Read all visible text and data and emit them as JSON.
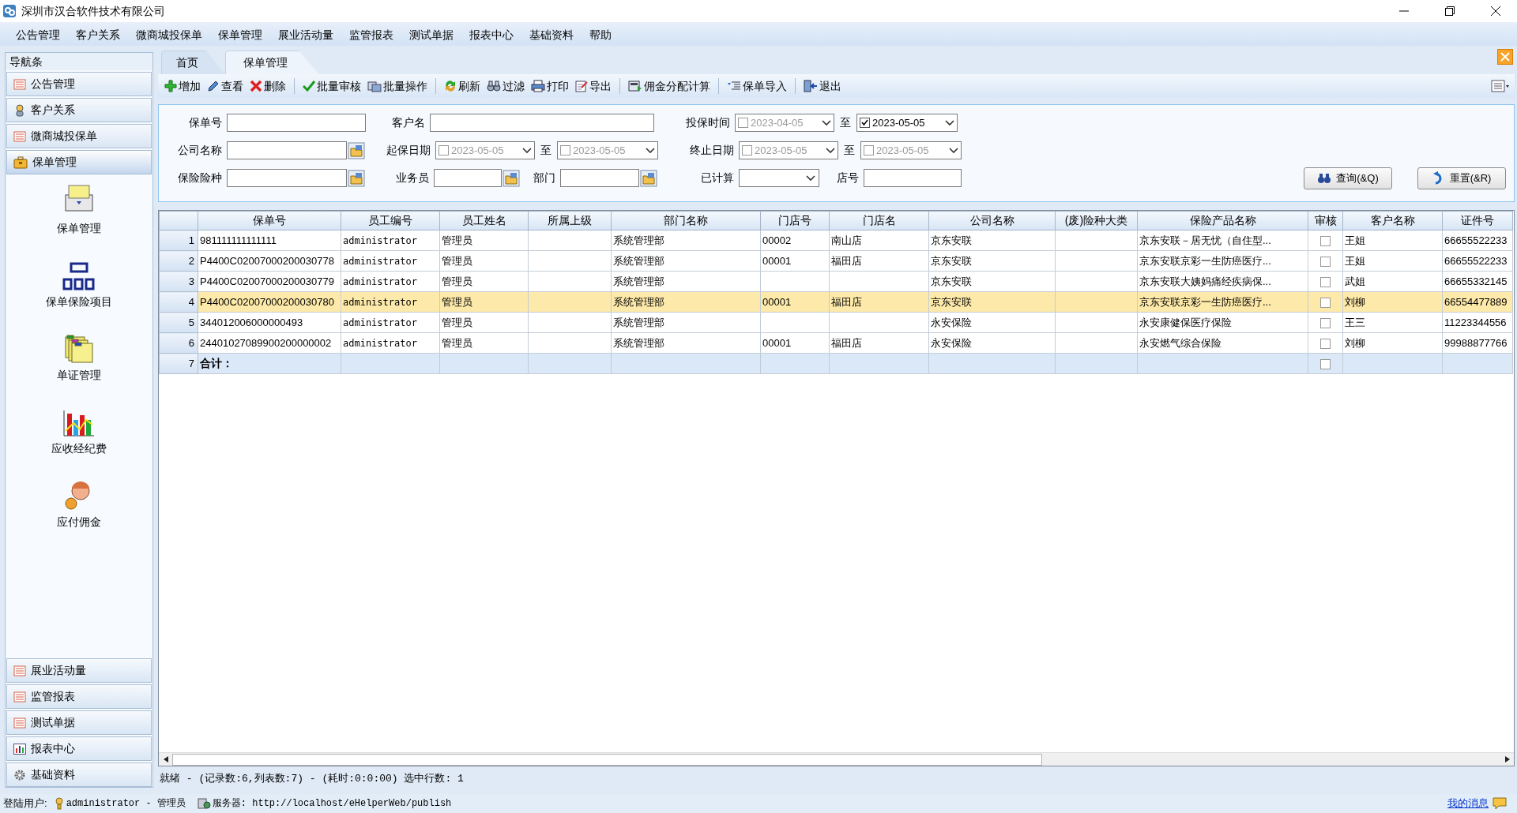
{
  "window": {
    "title": "深圳市汉合软件技术有限公司"
  },
  "menu": [
    "公告管理",
    "客户关系",
    "微商城投保单",
    "保单管理",
    "展业活动量",
    "监管报表",
    "测试单据",
    "报表中心",
    "基础资料",
    "帮助"
  ],
  "sidebar": {
    "title": "导航条",
    "top_sections": [
      {
        "label": "公告管理",
        "kind": "list",
        "expanded": false
      },
      {
        "label": "客户关系",
        "kind": "person",
        "expanded": false
      },
      {
        "label": "微商城投保单",
        "kind": "list",
        "expanded": false
      },
      {
        "label": "保单管理",
        "kind": "briefcase",
        "expanded": true
      }
    ],
    "items": [
      {
        "label": "保单管理",
        "kind": "file-box"
      },
      {
        "label": "保单保险项目",
        "kind": "org-chart"
      },
      {
        "label": "单证管理",
        "kind": "folders"
      },
      {
        "label": "应收经纪费",
        "kind": "bar-chart"
      },
      {
        "label": "应付佣金",
        "kind": "person"
      }
    ],
    "bottom_sections": [
      {
        "label": "展业活动量",
        "kind": "list",
        "expanded": false
      },
      {
        "label": "监管报表",
        "kind": "list",
        "expanded": false
      },
      {
        "label": "测试单据",
        "kind": "list",
        "expanded": false
      },
      {
        "label": "报表中心",
        "kind": "chart",
        "expanded": false
      },
      {
        "label": "基础资料",
        "kind": "gear",
        "expanded": false
      }
    ]
  },
  "tabs": [
    {
      "label": "首页",
      "selected": false
    },
    {
      "label": "保单管理",
      "selected": true
    }
  ],
  "toolbar": [
    [
      {
        "label": "增加",
        "kind": "add"
      },
      {
        "label": "查看",
        "kind": "edit"
      },
      {
        "label": "删除",
        "kind": "delete"
      }
    ],
    [
      {
        "label": "批量审核",
        "kind": "check"
      },
      {
        "label": "批量操作",
        "kind": "batch"
      }
    ],
    [
      {
        "label": "刷新",
        "kind": "refresh"
      },
      {
        "label": "过滤",
        "kind": "filter"
      },
      {
        "label": "打印",
        "kind": "print"
      },
      {
        "label": "导出",
        "kind": "export"
      }
    ],
    [
      {
        "label": "佣金分配计算",
        "kind": "calc"
      }
    ],
    [
      {
        "label": "保单导入",
        "kind": "import"
      }
    ],
    [
      {
        "label": "退出",
        "kind": "exit"
      }
    ]
  ],
  "filters": [
    [
      {
        "kind": "text",
        "label": "保单号"
      },
      {
        "kind": "text",
        "label": "客户名"
      },
      {
        "kind": "date_range",
        "label": "投保时间",
        "separator": "至",
        "from": {
          "checked": false,
          "value": "2023-04-05"
        },
        "to": {
          "checked": true,
          "value": "2023-05-05"
        }
      }
    ],
    [
      {
        "kind": "lookup",
        "label": "公司名称"
      },
      {
        "kind": "date_range",
        "label": "起保日期",
        "separator": "至",
        "from": {
          "checked": false,
          "value": "2023-05-05"
        },
        "to": {
          "checked": false,
          "value": "2023-05-05"
        }
      },
      {
        "kind": "date_range",
        "label": "终止日期",
        "separator": "至",
        "from": {
          "checked": false,
          "value": "2023-05-05"
        },
        "to": {
          "checked": false,
          "value": "2023-05-05"
        }
      }
    ],
    [
      {
        "kind": "lookup",
        "label": "保险险种"
      },
      {
        "kind": "lookup",
        "label": "业务员"
      },
      {
        "kind": "lookup",
        "label": "部门"
      },
      {
        "kind": "select",
        "label": "已计算"
      },
      {
        "kind": "text",
        "label": "店号"
      }
    ]
  ],
  "filter_buttons": [
    {
      "label": "查询(&Q)",
      "kind": "search"
    },
    {
      "label": "重置(&R)",
      "kind": "reset"
    }
  ],
  "table": {
    "columns": [
      {
        "label": "保单号",
        "kind": "text"
      },
      {
        "label": "员工编号",
        "kind": "code"
      },
      {
        "label": "员工姓名",
        "kind": "text"
      },
      {
        "label": "所属上级",
        "kind": "text"
      },
      {
        "label": "部门名称",
        "kind": "text"
      },
      {
        "label": "门店号",
        "kind": "text"
      },
      {
        "label": "门店名",
        "kind": "text"
      },
      {
        "label": "公司名称",
        "kind": "text"
      },
      {
        "label": "(废)险种大类",
        "kind": "text"
      },
      {
        "label": "保险产品名称",
        "kind": "text"
      },
      {
        "label": "审核",
        "kind": "checkbox"
      },
      {
        "label": "客户名称",
        "kind": "text"
      },
      {
        "label": "证件号",
        "kind": "text"
      }
    ],
    "rows": [
      {
        "number": "1",
        "kind": "data",
        "selected": false,
        "audited": false,
        "cells": [
          "981111111111111",
          "administrator",
          "管理员",
          null,
          "系统管理部",
          "00002",
          "南山店",
          "京东安联",
          null,
          "京东安联－居无忧（自住型...",
          null,
          "王姐",
          "66655522233"
        ]
      },
      {
        "number": "2",
        "kind": "data",
        "selected": false,
        "audited": false,
        "cells": [
          "P4400C02007000200030778",
          "administrator",
          "管理员",
          null,
          "系统管理部",
          "00001",
          "福田店",
          "京东安联",
          null,
          "京东安联京彩一生防癌医疗...",
          null,
          "王姐",
          "66655522233"
        ]
      },
      {
        "number": "3",
        "kind": "data",
        "selected": false,
        "audited": false,
        "cells": [
          "P4400C02007000200030779",
          "administrator",
          "管理员",
          null,
          "系统管理部",
          null,
          null,
          "京东安联",
          null,
          "京东安联大姨妈痛经疾病保...",
          null,
          "武姐",
          "66655332145"
        ]
      },
      {
        "number": "4",
        "kind": "data",
        "selected": true,
        "audited": false,
        "cells": [
          "P4400C02007000200030780",
          "administrator",
          "管理员",
          null,
          "系统管理部",
          "00001",
          "福田店",
          "京东安联",
          null,
          "京东安联京彩一生防癌医疗...",
          null,
          "刘柳",
          "66554477889"
        ]
      },
      {
        "number": "5",
        "kind": "data",
        "selected": false,
        "audited": false,
        "cells": [
          "344012006000000493",
          "administrator",
          "管理员",
          null,
          "系统管理部",
          null,
          null,
          "永安保险",
          null,
          "永安康健保医疗保险",
          null,
          "王三",
          "11223344556"
        ]
      },
      {
        "number": "6",
        "kind": "data",
        "selected": false,
        "audited": false,
        "cells": [
          "24401027089900200000002",
          "administrator",
          "管理员",
          null,
          "系统管理部",
          "00001",
          "福田店",
          "永安保险",
          null,
          "永安燃气综合保险",
          null,
          "刘柳",
          "99988877766"
        ]
      },
      {
        "number": "7",
        "kind": "total",
        "selected": false,
        "audited": false,
        "cells": [
          "合计：",
          null,
          null,
          null,
          null,
          null,
          null,
          null,
          null,
          null,
          null,
          null,
          null
        ]
      }
    ]
  },
  "status": "就绪 - (记录数:6,列表数:7) - (耗时:0:0:00) 选中行数: 1",
  "footer": {
    "user_label": "登陆用户:",
    "user": "administrator - 管理员",
    "server": "服务器: http://localhost/eHelperWeb/publish",
    "messages": "我的消息"
  }
}
